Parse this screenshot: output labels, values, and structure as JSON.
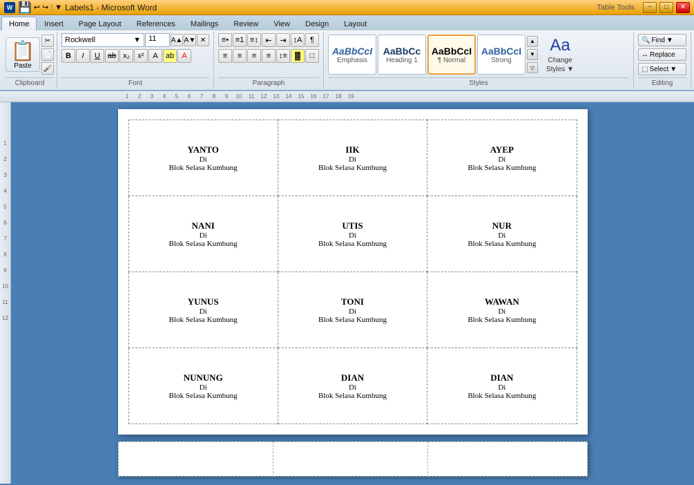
{
  "titlebar": {
    "title": "Labels1 - Microsoft Word",
    "tools_title": "Table Tools",
    "min": "−",
    "max": "□",
    "close": "✕"
  },
  "ribbon": {
    "tabs": [
      "Home",
      "Insert",
      "Page Layout",
      "References",
      "Mailings",
      "Review",
      "View",
      "Design",
      "Layout"
    ],
    "active_tab": "Home",
    "tools_tab": "Table Tools",
    "groups": {
      "clipboard": "Clipboard",
      "font": "Font",
      "paragraph": "Paragraph",
      "styles": "Styles",
      "editing": "Editing"
    },
    "font": {
      "name": "Rockwell",
      "size": "11"
    },
    "styles": [
      {
        "label": "Emphasis",
        "text": "AaBbCcI",
        "style": "italic"
      },
      {
        "label": "Heading 1",
        "text": "AaBbCc",
        "style": "heading"
      },
      {
        "label": "¶ Normal",
        "text": "AaBbCcI",
        "style": "normal",
        "active": true
      },
      {
        "label": "Strong",
        "text": "AaBbCcI",
        "style": "strong"
      }
    ],
    "change_styles": "Change Styles",
    "find_label": "Find",
    "replace_label": "Replace",
    "select_label": "Select"
  },
  "labels": [
    [
      {
        "name": "YANTO",
        "line2": "Di",
        "line3": "Blok Selasa Kumbung"
      },
      {
        "name": "IIK",
        "line2": "Di",
        "line3": "Blok Selasa Kumbung"
      },
      {
        "name": "AYEP",
        "line2": "Di",
        "line3": "Blok Selasa Kumbung"
      }
    ],
    [
      {
        "name": "NANI",
        "line2": "Di",
        "line3": "Blok Selasa Kumbung"
      },
      {
        "name": "UTIS",
        "line2": "Di",
        "line3": "Blok Selasa Kumbung"
      },
      {
        "name": "NUR",
        "line2": "Di",
        "line3": "Blok Selasa Kumbung"
      }
    ],
    [
      {
        "name": "YUNUS",
        "line2": "Di",
        "line3": "Blok Selasa Kumbung"
      },
      {
        "name": "TONI",
        "line2": "Di",
        "line3": "Blok Selasa Kumbung"
      },
      {
        "name": "WAWAN",
        "line2": "Di",
        "line3": "Blok Selasa Kumbung"
      }
    ],
    [
      {
        "name": "NUNUNG",
        "line2": "Di",
        "line3": "Blok Selasa Kumbung"
      },
      {
        "name": "DIAN",
        "line2": "Di",
        "line3": "Blok Selasa Kumbung"
      },
      {
        "name": "DIAN",
        "line2": "Di",
        "line3": "Blok Selasa Kumbung"
      }
    ]
  ],
  "ruler": {
    "marks": [
      "1",
      "2",
      "3",
      "4",
      "5",
      "6",
      "7",
      "8",
      "9",
      "10",
      "11",
      "12",
      "13",
      "14",
      "15",
      "16",
      "17",
      "18",
      "19"
    ]
  }
}
